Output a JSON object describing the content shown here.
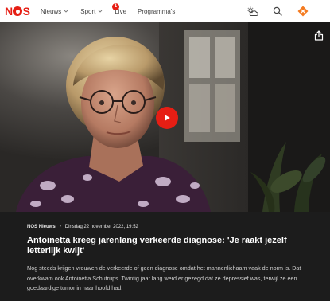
{
  "header": {
    "logo_text": "NOS",
    "nav": [
      {
        "label": "Nieuws",
        "has_dropdown": true
      },
      {
        "label": "Sport",
        "has_dropdown": true
      },
      {
        "label": "Live",
        "badge": "1"
      },
      {
        "label": "Programma's"
      }
    ],
    "icons": [
      "weather-icon",
      "search-icon",
      "npo-icon"
    ]
  },
  "media": {
    "play_icon": "play-icon",
    "share_icon": "share-icon"
  },
  "article": {
    "source": "NOS Nieuws",
    "separator": "•",
    "date": "Dinsdag 22 november 2022, 19:52",
    "headline": "Antoinetta kreeg jarenlang verkeerde diagnose: 'Je raakt jezelf letterlijk kwijt'",
    "summary": "Nog steeds krijgen vrouwen de verkeerde of geen diagnose omdat het mannenlichaam vaak de norm is. Dat overkwam ook Antoinetta Schutrups. Twintig jaar lang werd er gezegd dat ze depressief was, terwijl ze een goedaardige tumor in haar hoofd had."
  },
  "colors": {
    "brand_red": "#e61e14",
    "article_bg": "#1c1c1c",
    "header_bg": "#ffffff"
  }
}
